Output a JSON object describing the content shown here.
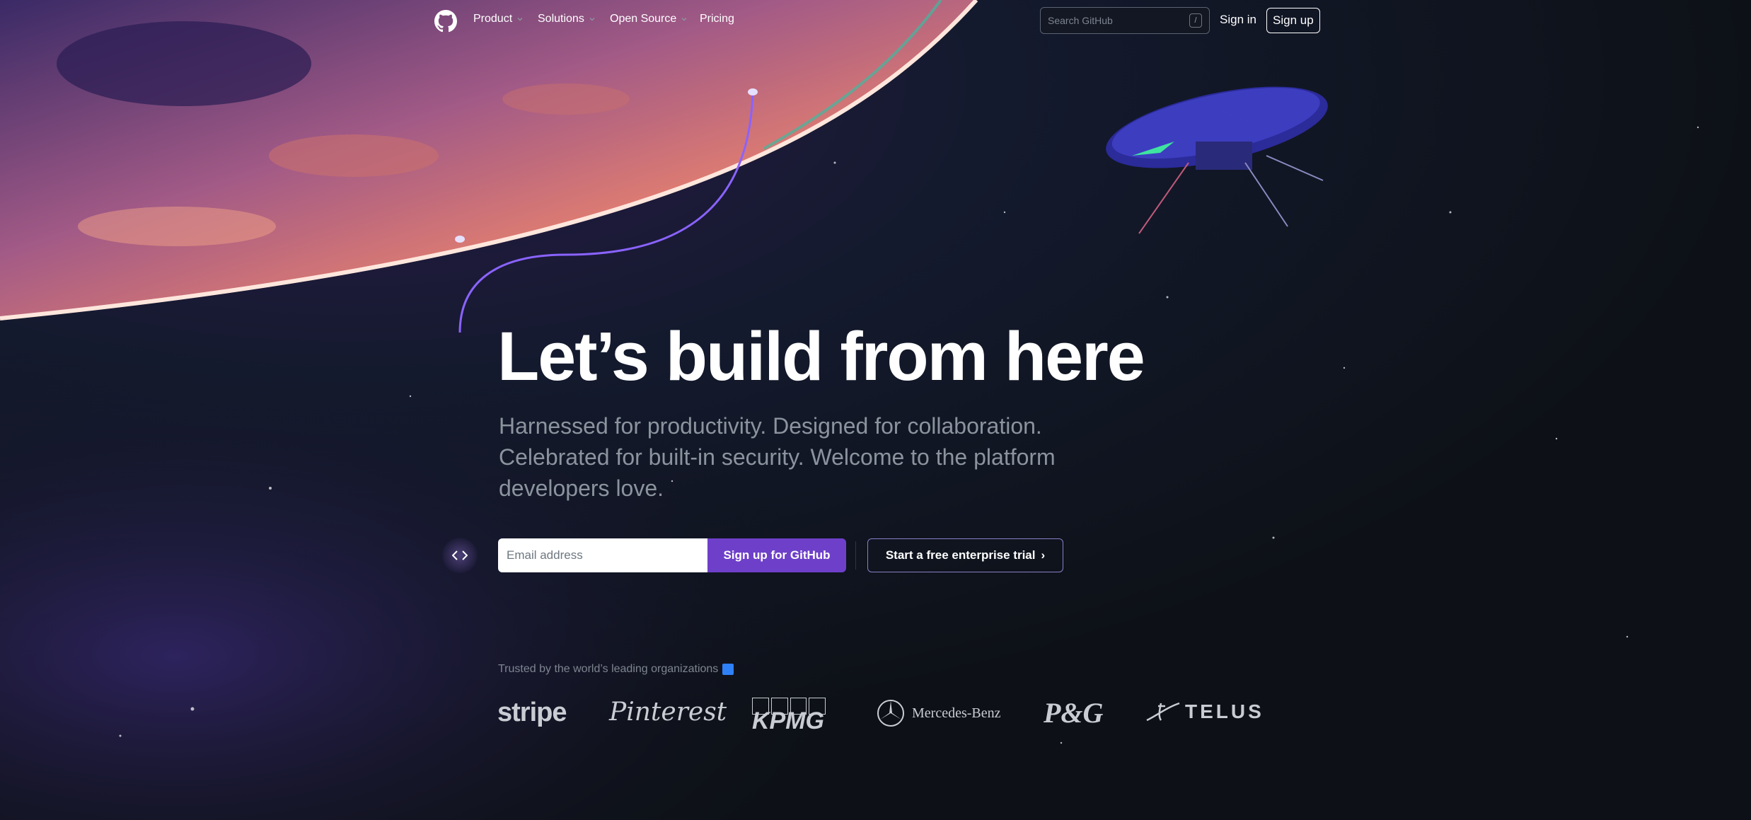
{
  "nav": {
    "items": [
      {
        "label": "Product",
        "has_dropdown": true
      },
      {
        "label": "Solutions",
        "has_dropdown": true
      },
      {
        "label": "Open Source",
        "has_dropdown": true
      },
      {
        "label": "Pricing",
        "has_dropdown": false
      }
    ],
    "search": {
      "placeholder": "Search GitHub",
      "shortcut": "/"
    },
    "sign_in": "Sign in",
    "sign_up": "Sign up"
  },
  "hero": {
    "title": "Let’s build from here",
    "subtitle": "Harnessed for productivity. Designed for collaboration. Celebrated for built-in security. Welcome to the platform developers love.",
    "email_placeholder": "Email address",
    "signup_button": "Sign up for GitHub",
    "trial_button": "Start a free enterprise trial",
    "trial_chevron": "›"
  },
  "trusted": {
    "label": "Trusted by the world’s leading organizations",
    "logos": [
      "stripe",
      "Pinterest",
      "KPMG",
      "Mercedes-Benz",
      "P&G",
      "TELUS"
    ]
  },
  "icons": {
    "logo": "github-octocat-icon",
    "code": "code-brackets-icon",
    "trusted": "arrow-icon"
  },
  "colors": {
    "background": "#0d1117",
    "accent_purple": "#6e40c9",
    "planet": "#e97a6a",
    "muted_text": "#8b949e"
  }
}
